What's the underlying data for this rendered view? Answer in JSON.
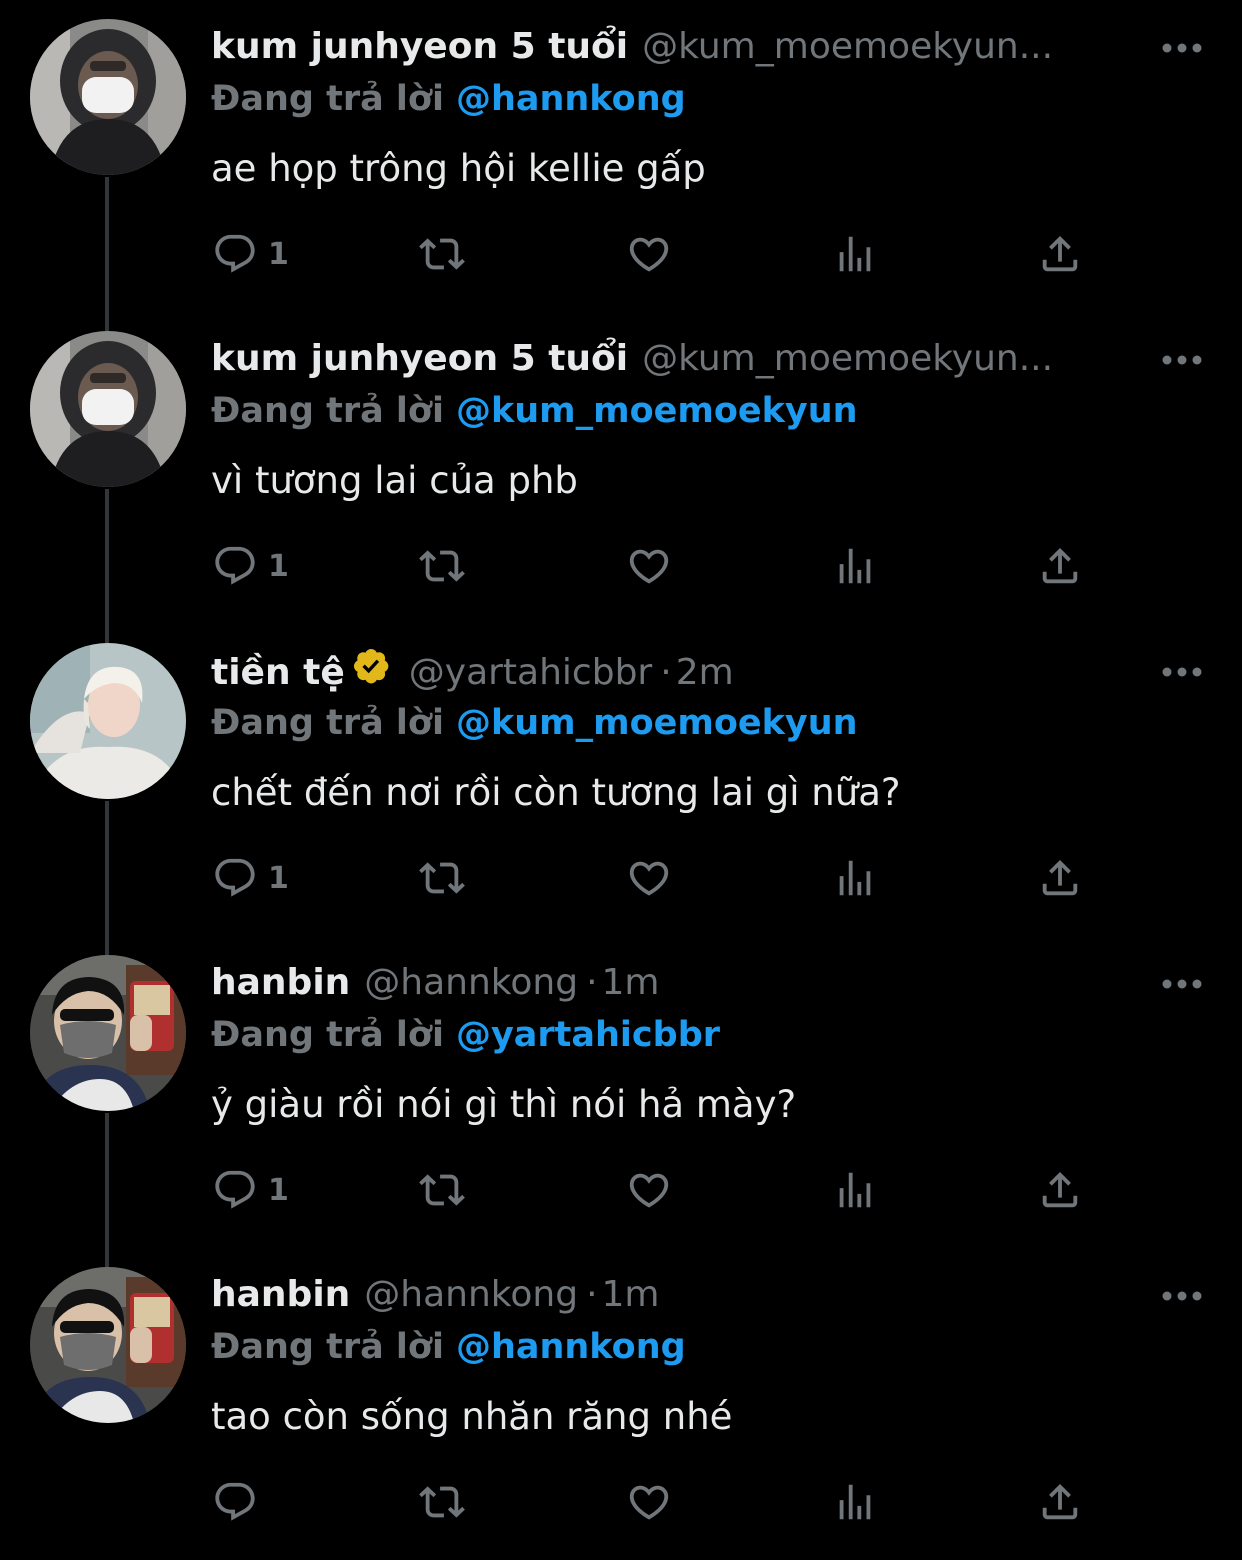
{
  "colors": {
    "background": "#000000",
    "text_primary": "#e7e9ea",
    "text_secondary": "#71767b",
    "mention": "#1d9bf0",
    "verified_badge": "#e2b719",
    "thread_line": "#333639"
  },
  "tweets": [
    {
      "name": "kum junhyeon 5 tuổi",
      "handle": "@kum_moemoekyun...",
      "time": "",
      "verified": false,
      "replying_label": "Đang trả lời",
      "replying_to": "@hannkong",
      "text": "ae họp trông hội kellie gấp",
      "reply_count": "1",
      "avatar": "masked-hooded-person"
    },
    {
      "name": "kum junhyeon 5 tuổi",
      "handle": "@kum_moemoekyun...",
      "time": "",
      "verified": false,
      "replying_label": "Đang trả lời",
      "replying_to": "@kum_moemoekyun",
      "text": "vì tương lai của phb",
      "reply_count": "1",
      "avatar": "masked-hooded-person"
    },
    {
      "name": "tiền tệ",
      "handle": "@yartahicbbr",
      "time": "2m",
      "verified": true,
      "replying_label": "Đang trả lời",
      "replying_to": "@kum_moemoekyun",
      "text": "chết đến nơi rồi còn tương lai gì nữa?",
      "reply_count": "1",
      "avatar": "blonde-person"
    },
    {
      "name": "hanbin",
      "handle": "@hannkong",
      "time": "1m",
      "verified": false,
      "replying_label": "Đang trả lời",
      "replying_to": "@yartahicbbr",
      "text": "ỷ giàu rồi nói gì thì nói hả mày?",
      "reply_count": "1",
      "avatar": "masked-selfie-person"
    },
    {
      "name": "hanbin",
      "handle": "@hannkong",
      "time": "1m",
      "verified": false,
      "replying_label": "Đang trả lời",
      "replying_to": "@hannkong",
      "text": "tao còn sống nhăn răng nhé",
      "reply_count": "",
      "avatar": "masked-selfie-person"
    }
  ]
}
